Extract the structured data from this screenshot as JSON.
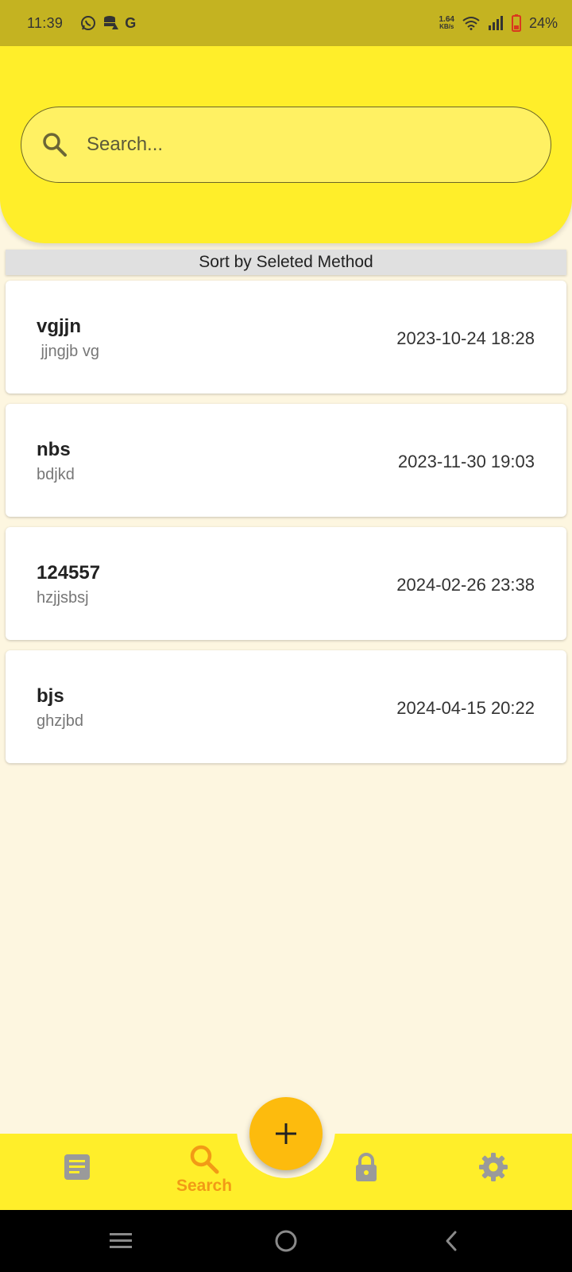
{
  "status_bar": {
    "time": "11:39",
    "left_icons": [
      "whatsapp-icon",
      "database-icon",
      "google-icon"
    ],
    "net_speed_value": "1.64",
    "net_speed_unit": "KB/s",
    "battery_percent": "24%"
  },
  "search": {
    "placeholder": "Search..."
  },
  "sort_bar": {
    "label": "Sort by Seleted Method"
  },
  "notes": [
    {
      "title": "vgjjn",
      "subtitle": " jjngjb vg",
      "date": "2023-10-24 18:28"
    },
    {
      "title": "nbs",
      "subtitle": "bdjkd",
      "date": "2023-11-30 19:03"
    },
    {
      "title": "124557",
      "subtitle": "hzjjsbsj",
      "date": "2024-02-26 23:38"
    },
    {
      "title": "bjs",
      "subtitle": "ghzjbd",
      "date": "2024-04-15 20:22"
    }
  ],
  "bottom_nav": {
    "items": [
      {
        "icon": "notes-icon",
        "label": ""
      },
      {
        "icon": "search-icon",
        "label": "Search",
        "active": true
      },
      {
        "icon": "lock-icon",
        "label": ""
      },
      {
        "icon": "settings-icon",
        "label": ""
      }
    ],
    "fab_icon": "plus-icon"
  },
  "colors": {
    "header": "#ffee2a",
    "status_bar": "#c4b321",
    "background": "#fdf6e0",
    "fab": "#fdbb0d",
    "active_nav": "#f29a16",
    "inactive_nav": "#9a9a9a"
  }
}
